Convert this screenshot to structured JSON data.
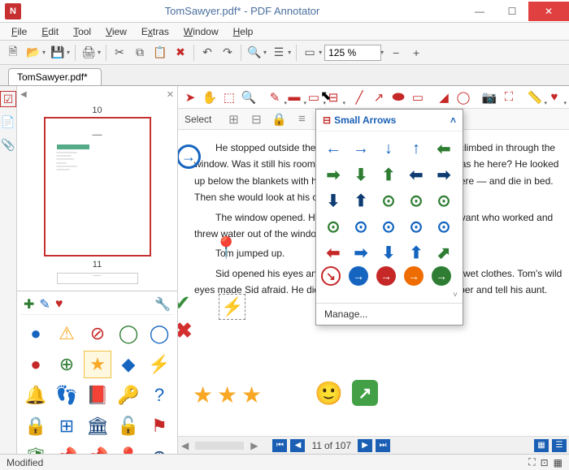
{
  "title": "TomSawyer.pdf* - PDF Annotator",
  "menu": [
    "File",
    "Edit",
    "Tool",
    "View",
    "Extras",
    "Window",
    "Help"
  ],
  "doctab": "TomSawyer.pdf*",
  "zoom": "125 %",
  "thumbs": {
    "page_top": "10",
    "page_bottom": "11"
  },
  "sub_toolbar": {
    "select_label": "Select"
  },
  "popup": {
    "title": "Small Arrows",
    "manage": "Manage..."
  },
  "doc": {
    "p1": "He stopped outside the house. There was no sound. He climbed in through the window. Was it still his room? He lay down on the bed. Why was he here? He looked up below the blankets with his hands. He could feel clothes there — and die in bed. Then she would look at his cold, dead body and see him.",
    "p2": "The window opened. He heard the voice of his aunt's servant who worked and threw water out of the window and it fell on him.",
    "p3a": "Tom jumped up.",
    "p3b": "Sid opened his eyes and saw him, ready for bed in those wet clothes. Tom's wild eyes made Sid afraid. He did not speak. But he would remember and tell his aunt."
  },
  "nav": {
    "page": "11",
    "total": "107",
    "of_label": "of"
  },
  "status": {
    "modified": "Modified"
  }
}
